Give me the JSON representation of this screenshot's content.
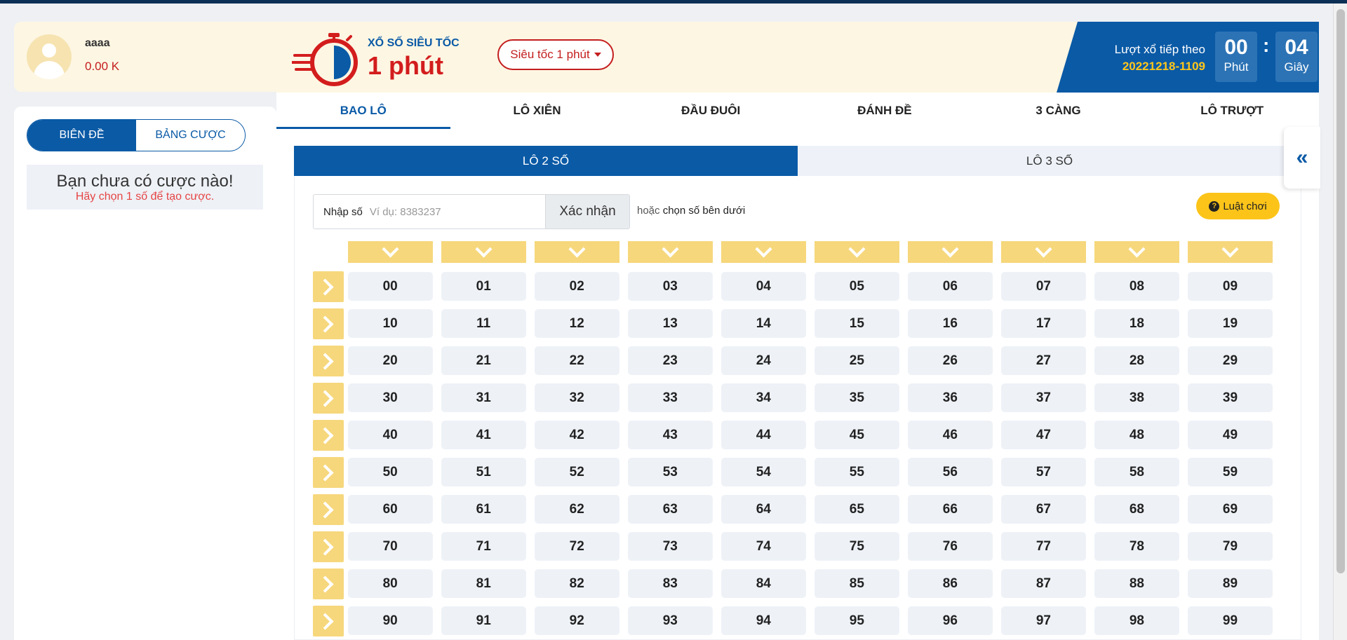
{
  "user": {
    "name": "aaaa",
    "balance": "0.00 K"
  },
  "bet_panel": {
    "tabs": [
      "BIÊN ĐỀ",
      "BẢNG CƯỢC"
    ],
    "empty_title": "Bạn chưa có cược nào!",
    "empty_sub": "Hãy chọn 1 số để tạo cược."
  },
  "header": {
    "logo_small": "XỔ SỐ SIÊU TỐC",
    "logo_big": "1 phút",
    "mode_select": "Siêu tốc 1 phút",
    "next_draw_label": "Lượt xổ tiếp theo",
    "next_draw_id": "20221218-1109",
    "minutes": "00",
    "minutes_label": "Phút",
    "separator": ":",
    "seconds": "04",
    "seconds_label": "Giây"
  },
  "tabs": [
    "BAO LÔ",
    "LÔ XIÊN",
    "ĐẦU ĐUÔI",
    "ĐÁNH ĐỀ",
    "3 CÀNG",
    "LÔ TRƯỢT"
  ],
  "active_tab": 0,
  "subtabs": [
    "LÔ 2 SỐ",
    "LÔ 3 SỐ"
  ],
  "active_subtab": 0,
  "input": {
    "label": "Nhập số",
    "placeholder": "Ví dụ: 8383237",
    "confirm": "Xác nhận",
    "or_text": "hoặc",
    "or_strong": "chọn số bên dưới"
  },
  "rules_button": "Luật chơi",
  "side_toggle": "«",
  "colors": {
    "primary": "#0a5aa6",
    "accent_red": "#c41e1e",
    "yellow": "#f6d77c",
    "gold": "#fcc419"
  },
  "number_grid": [
    [
      "00",
      "01",
      "02",
      "03",
      "04",
      "05",
      "06",
      "07",
      "08",
      "09"
    ],
    [
      "10",
      "11",
      "12",
      "13",
      "14",
      "15",
      "16",
      "17",
      "18",
      "19"
    ],
    [
      "20",
      "21",
      "22",
      "23",
      "24",
      "25",
      "26",
      "27",
      "28",
      "29"
    ],
    [
      "30",
      "31",
      "32",
      "33",
      "34",
      "35",
      "36",
      "37",
      "38",
      "39"
    ],
    [
      "40",
      "41",
      "42",
      "43",
      "44",
      "45",
      "46",
      "47",
      "48",
      "49"
    ],
    [
      "50",
      "51",
      "52",
      "53",
      "54",
      "55",
      "56",
      "57",
      "58",
      "59"
    ],
    [
      "60",
      "61",
      "62",
      "63",
      "64",
      "65",
      "66",
      "67",
      "68",
      "69"
    ],
    [
      "70",
      "71",
      "72",
      "73",
      "74",
      "75",
      "76",
      "77",
      "78",
      "79"
    ],
    [
      "80",
      "81",
      "82",
      "83",
      "84",
      "85",
      "86",
      "87",
      "88",
      "89"
    ],
    [
      "90",
      "91",
      "92",
      "93",
      "94",
      "95",
      "96",
      "97",
      "98",
      "99"
    ]
  ]
}
